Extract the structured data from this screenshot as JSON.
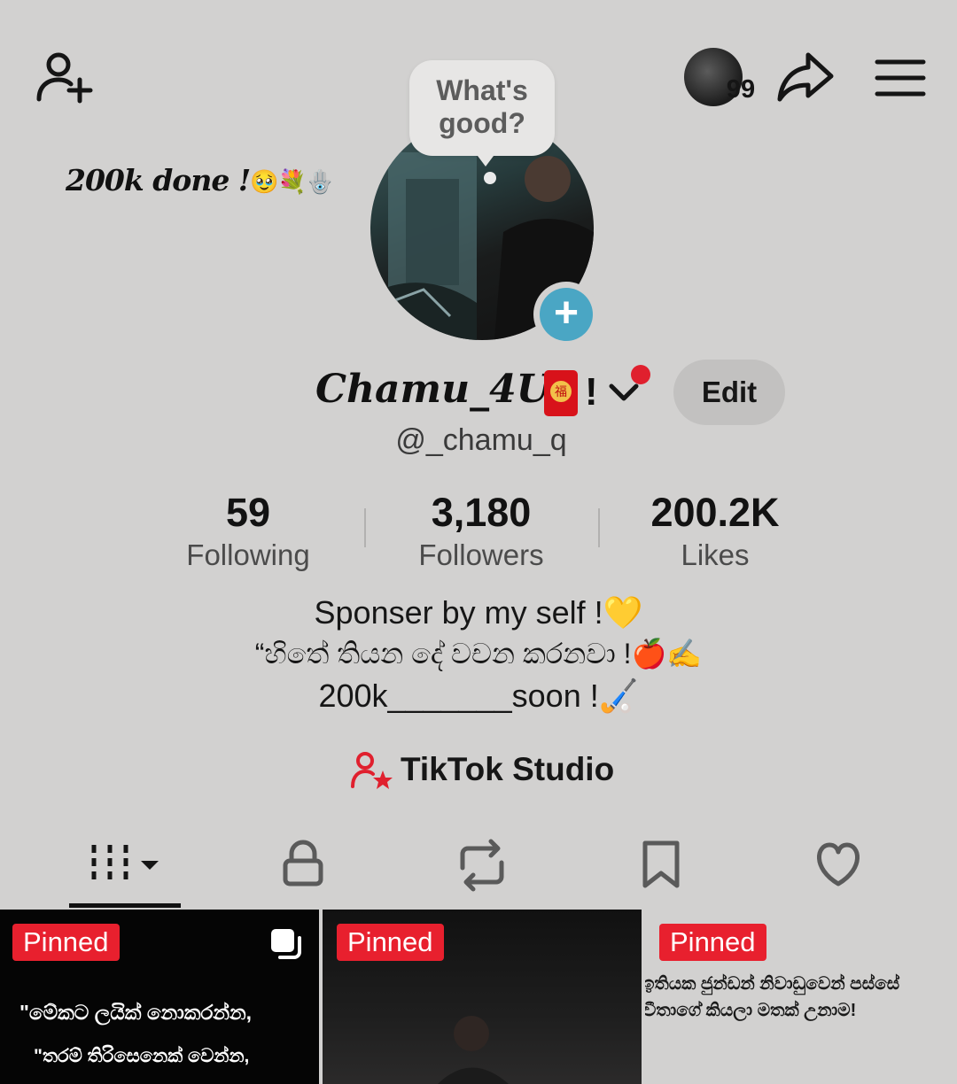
{
  "header": {
    "note_text": "What's good?",
    "notification_count": "99",
    "side_caption": "200k done !",
    "side_caption_emojis": "🥹💐🪬"
  },
  "profile": {
    "display_name": "Chamu_4U",
    "name_suffix": "!",
    "username": "@_chamu_q",
    "edit_label": "Edit"
  },
  "stats": [
    {
      "value": "59",
      "label": "Following"
    },
    {
      "value": "3,180",
      "label": "Followers"
    },
    {
      "value": "200.2K",
      "label": "Likes"
    }
  ],
  "bio": {
    "line1": "Sponser by my self !💛",
    "line2": "“හිතේ තියන දේ වචන කරනවා !🍎✍️",
    "line3": "200k_______soon !🏑"
  },
  "studio_label": "TikTok Studio",
  "tabs": [
    {
      "icon": "videos-grid-icon"
    },
    {
      "icon": "lock-icon"
    },
    {
      "icon": "repost-icon"
    },
    {
      "icon": "bookmark-icon"
    },
    {
      "icon": "heart-icon"
    }
  ],
  "videos": [
    {
      "badge": "Pinned",
      "caption_line1": "\"මේකට ලයික් නොකරන්න,",
      "caption_line2": "\"තරම් තිරිසෙනෙක් වෙන්න,"
    },
    {
      "badge": "Pinned"
    },
    {
      "badge": "Pinned",
      "caption_line1": "ඉතියක ජුන්ඩන් නිවාඩුවෙන් පස්සේ",
      "caption_line2": "වීතාගේ කියලා මතක් උනාම!"
    }
  ],
  "colors": {
    "background": "#d2d1d0",
    "pinned_badge": "#e8202e",
    "plus_badge": "#4aa6c4",
    "studio_accent": "#e0202e",
    "notification_dot": "#e0202e"
  }
}
